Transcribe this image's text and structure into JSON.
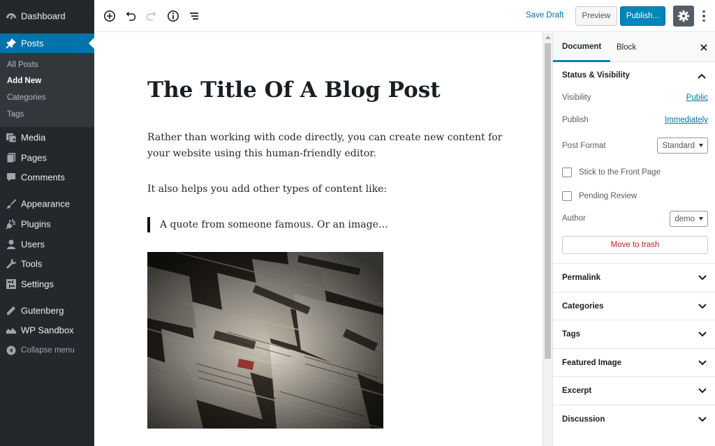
{
  "admin_menu": {
    "items": [
      {
        "label": "Dashboard",
        "icon": "dashboard-icon"
      },
      {
        "label": "Posts",
        "icon": "pin-icon",
        "current": true
      },
      {
        "label": "Media",
        "icon": "media-icon"
      },
      {
        "label": "Pages",
        "icon": "pages-icon"
      },
      {
        "label": "Comments",
        "icon": "comments-icon"
      },
      {
        "label": "Appearance",
        "icon": "brush-icon"
      },
      {
        "label": "Plugins",
        "icon": "plug-icon"
      },
      {
        "label": "Users",
        "icon": "user-icon"
      },
      {
        "label": "Tools",
        "icon": "wrench-icon"
      },
      {
        "label": "Settings",
        "icon": "settings-icon"
      },
      {
        "label": "Gutenberg",
        "icon": "pencil-icon"
      },
      {
        "label": "WP Sandbox",
        "icon": "cloud-icon"
      }
    ],
    "submenu": [
      {
        "label": "All Posts"
      },
      {
        "label": "Add New",
        "current": true
      },
      {
        "label": "Categories"
      },
      {
        "label": "Tags"
      }
    ],
    "collapse_label": "Collapse menu"
  },
  "toolbar": {
    "icons": [
      "add-block-icon",
      "undo-icon",
      "redo-icon",
      "info-icon",
      "outline-icon"
    ],
    "save_draft": "Save Draft",
    "preview": "Preview",
    "publish": "Publish...",
    "settings_icon": "gear-icon",
    "more_icon": "more-vertical-icon"
  },
  "post": {
    "title": "The Title Of A Blog Post",
    "para1_line1": "Rather than working with code directly, you can create new content for",
    "para1_line2": "your website using this human-friendly editor.",
    "para2": "It also helps you add other types of content like:",
    "quote": "A quote from someone famous. Or an image…"
  },
  "sidebar": {
    "tabs": {
      "document": "Document",
      "block": "Block"
    },
    "status": {
      "title": "Status & Visibility",
      "visibility_label": "Visibility",
      "visibility_value": "Public",
      "publish_label": "Publish",
      "publish_value": "Immediately",
      "post_format_label": "Post Format",
      "post_format_value": "Standard",
      "sticky_label": "Stick to the Front Page",
      "pending_label": "Pending Review",
      "author_label": "Author",
      "author_value": "demo",
      "trash": "Move to trash"
    },
    "panels": [
      "Permalink",
      "Categories",
      "Tags",
      "Featured Image",
      "Excerpt",
      "Discussion"
    ]
  },
  "colors": {
    "admin_bg": "#23282d",
    "admin_accent": "#0073aa",
    "publish_button": "#0085ba",
    "trash_text": "#b52727"
  }
}
